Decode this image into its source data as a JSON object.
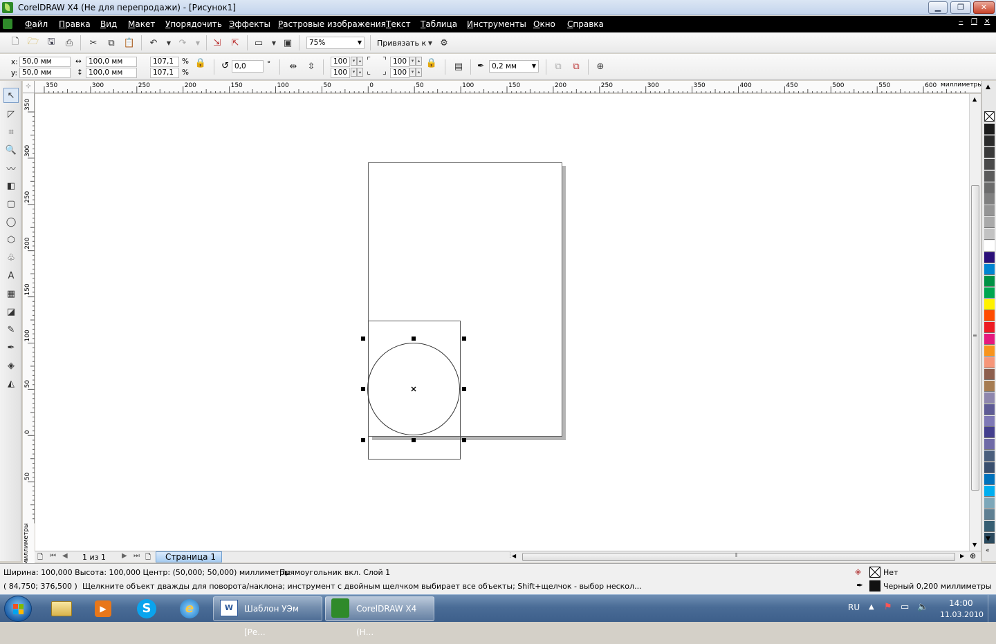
{
  "window": {
    "title": "CorelDRAW X4 (Не для перепродажи) - [Рисунок1]"
  },
  "menu": [
    "Файл",
    "Правка",
    "Вид",
    "Макет",
    "Упорядочить",
    "Эффекты",
    "Растровые изображения",
    "Текст",
    "Таблица",
    "Инструменты",
    "Окно",
    "Справка"
  ],
  "toolbar": {
    "zoom": "75%",
    "snap_label": "Привязать к"
  },
  "properties": {
    "x_label": "x:",
    "x": "50,0 мм",
    "y_label": "y:",
    "y": "50,0 мм",
    "width": "100,0 мм",
    "height": "100,0 мм",
    "scale_x": "107,1",
    "scale_y": "107,1",
    "percent": "%",
    "angle": "0,0",
    "degree": "°",
    "corner_1": "100",
    "corner_2": "100",
    "corner_3": "100",
    "corner_4": "100",
    "outline_width": "0,2 мм"
  },
  "ruler": {
    "h_ticks": [
      "350",
      "300",
      "250",
      "200",
      "150",
      "100",
      "50",
      "0",
      "50",
      "100",
      "150",
      "200",
      "250",
      "300",
      "350",
      "400",
      "450",
      "500",
      "550",
      "600"
    ],
    "v_ticks": [
      "350",
      "300",
      "250",
      "200",
      "150",
      "100",
      "50",
      "0",
      "50"
    ],
    "units": "миллиметры",
    "v_units": "миллиметры"
  },
  "palette": {
    "colors": [
      "#1c1c1c",
      "#2b2b2b",
      "#3a3a3a",
      "#4a4a4a",
      "#5b5b5b",
      "#6c6c6c",
      "#808080",
      "#959595",
      "#aaaaaa",
      "#c2c2c2",
      "#ffffff",
      "#2a0f78",
      "#0085d1",
      "#009245",
      "#00a650",
      "#fff200",
      "#ff4c00",
      "#ed1c24",
      "#e5197e",
      "#f7941d",
      "#f69679",
      "#8d5f4e",
      "#a67c52",
      "#8e86ad",
      "#5e5b95",
      "#7e78b6",
      "#443f8e",
      "#6f6aa7",
      "#4a5e7c",
      "#3a4f6e",
      "#0072bc",
      "#00aeef",
      "#7da7b9",
      "#5f7f92",
      "#375e72",
      "#2b4a5e"
    ]
  },
  "pagebar": {
    "page_count": "1 из 1",
    "page_tab": "Страница 1"
  },
  "status": {
    "line1_left": "Ширина: 100,000  Высота: 100,000  Центр: (50,000; 50,000)  миллиметры",
    "line1_mid": "Прямоугольник вкл. Слой 1",
    "fill_label": "Нет",
    "line2_coords": "( 84,750; 376,500 )",
    "line2_hint": "Щелкните объект дважды для поворота/наклона; инструмент с двойным щелчком выбирает все объекты; Shift+щелчок - выбор нескол...",
    "outline_label": "Черный  0,200 миллиметры"
  },
  "taskbar": {
    "items": [
      "Шаблон УЭм [Ре...",
      "CorelDRAW X4 (Н..."
    ],
    "lang": "RU",
    "time": "14:00",
    "date": "11.03.2010"
  }
}
